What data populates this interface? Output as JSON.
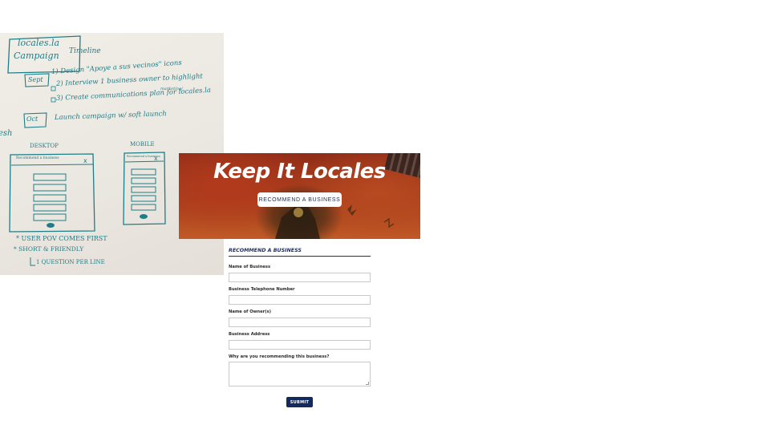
{
  "whiteboard": {
    "title_line1": "locales.la",
    "title_line2": "Campaign",
    "timeline_label": "Timeline",
    "sept_label": "Sept",
    "line1": "1) Design \"Apoye a sus vecinos\" icons",
    "line2": "2) Interview 1 business owner to highlight",
    "line2b": "marketing/",
    "line3": "3) Create communications plan for locales.la",
    "oct_label": "Oct",
    "line4": "Launch campaign w/ soft launch",
    "left_edge_text": "esh",
    "desktop_label": "DESKTOP",
    "mobile_label": "MOBILE",
    "sketch_desktop_title": "Recommend a business",
    "sketch_mobile_title": "Recommend a business",
    "note1": "* USER POV COMES FIRST",
    "note2": "* SHORT & FRIENDLY",
    "note3": "1 QUESTION PER LINE"
  },
  "hero": {
    "title": "Keep It Locales",
    "button_label": "RECOMMEND A BUSINESS"
  },
  "form": {
    "title": "RECOMMEND A BUSINESS",
    "fields": [
      {
        "label": "Name of Business",
        "value": ""
      },
      {
        "label": "Business Telephone Number",
        "value": ""
      },
      {
        "label": "Name of Owner(s)",
        "value": ""
      },
      {
        "label": "Business Address",
        "value": ""
      },
      {
        "label": "Why are you recommending this business?",
        "value": ""
      }
    ],
    "submit_label": "SUBMIT"
  },
  "colors": {
    "marker": "#1f7d86",
    "navy": "#132a5e",
    "hero_red": "#a73d1c"
  }
}
